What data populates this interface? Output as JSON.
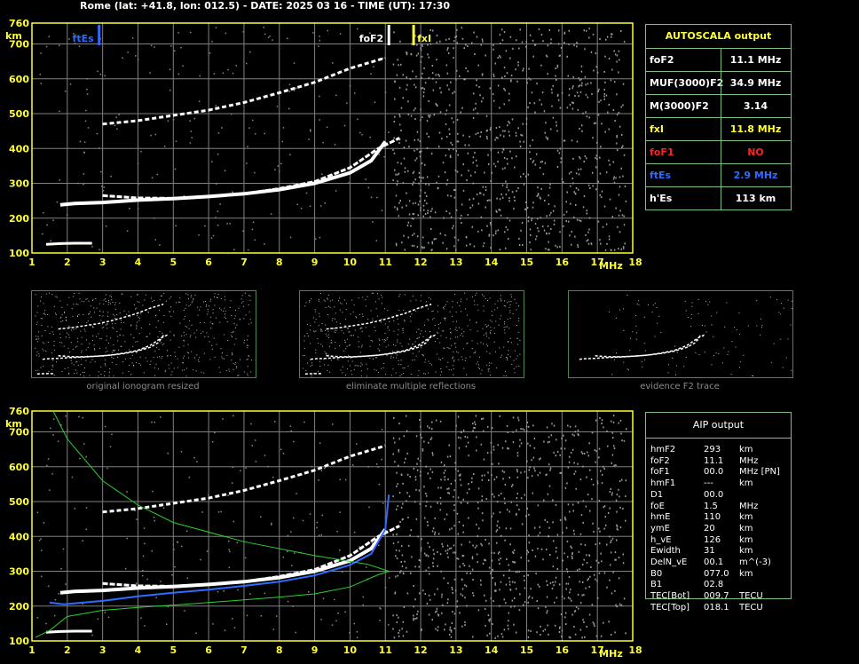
{
  "header": "Rome (lat: +41.8, lon: 012.5) - DATE: 2025 03 16 - TIME (UT): 17:30",
  "colors": {
    "grid": "#808080",
    "axis": "#ffff33",
    "frame": "#ffff33",
    "trace": "#ffffff",
    "blue": "#2f6bff",
    "green": "#2bd12b",
    "red": "#ff2020",
    "panelBorder": "#7fbf7f"
  },
  "chart_data": [
    {
      "type": "scatter",
      "title": "",
      "xlabel": "MHz",
      "ylabel": "km",
      "xlim": [
        1,
        18
      ],
      "ylim": [
        100,
        760
      ],
      "x_ticks": [
        1,
        2,
        3,
        4,
        5,
        6,
        7,
        8,
        9,
        10,
        11,
        12,
        13,
        14,
        15,
        16,
        17,
        18
      ],
      "y_ticks": [
        100,
        200,
        300,
        400,
        500,
        600,
        700,
        760
      ],
      "grid": true,
      "markers": [
        {
          "label": "ftEs",
          "x": 2.9,
          "color": "#2f6bff"
        },
        {
          "label": "foF2",
          "x": 11.1,
          "color": "#ffffff"
        },
        {
          "label": "fxI",
          "x": 11.8,
          "color": "#ffff33"
        }
      ],
      "series": [
        {
          "values": [
            [
              1.4,
              125
            ],
            [
              1.8,
              127
            ],
            [
              2.2,
              128
            ],
            [
              2.7,
              128
            ]
          ]
        },
        {
          "values": [
            [
              1.8,
              238
            ],
            [
              2.2,
              242
            ],
            [
              3,
              245
            ],
            [
              4,
              252
            ],
            [
              5,
              256
            ],
            [
              6,
              262
            ],
            [
              7,
              270
            ],
            [
              8,
              282
            ],
            [
              9,
              300
            ],
            [
              10,
              330
            ],
            [
              10.6,
              365
            ],
            [
              11,
              420
            ]
          ]
        },
        {
          "values": [
            [
              3,
              265
            ],
            [
              4,
              258
            ],
            [
              5,
              257
            ],
            [
              6,
              262
            ],
            [
              7,
              270
            ],
            [
              8,
              285
            ],
            [
              9,
              305
            ],
            [
              10,
              345
            ],
            [
              10.8,
              400
            ],
            [
              11.4,
              430
            ]
          ]
        },
        {
          "values": [
            [
              3,
              470
            ],
            [
              4,
              480
            ],
            [
              5,
              495
            ],
            [
              6,
              510
            ],
            [
              7,
              532
            ],
            [
              8,
              560
            ],
            [
              9,
              590
            ],
            [
              10,
              630
            ],
            [
              11,
              660
            ]
          ]
        }
      ]
    },
    {
      "type": "scatter",
      "title": "",
      "xlabel": "MHz",
      "ylabel": "km",
      "xlim": [
        1,
        18
      ],
      "ylim": [
        100,
        760
      ],
      "x_ticks": [
        1,
        2,
        3,
        4,
        5,
        6,
        7,
        8,
        9,
        10,
        11,
        12,
        13,
        14,
        15,
        16,
        17,
        18
      ],
      "y_ticks": [
        100,
        200,
        300,
        400,
        500,
        600,
        700,
        760
      ],
      "grid": true,
      "series": [
        {
          "values": [
            [
              1.4,
              125
            ],
            [
              1.8,
              127
            ],
            [
              2.2,
              128
            ],
            [
              2.7,
              128
            ]
          ]
        },
        {
          "values": [
            [
              1.8,
              238
            ],
            [
              2.2,
              242
            ],
            [
              3,
              245
            ],
            [
              4,
              252
            ],
            [
              5,
              256
            ],
            [
              6,
              262
            ],
            [
              7,
              270
            ],
            [
              8,
              282
            ],
            [
              9,
              300
            ],
            [
              10,
              330
            ],
            [
              10.6,
              365
            ],
            [
              11,
              420
            ]
          ]
        },
        {
          "values": [
            [
              3,
              265
            ],
            [
              4,
              258
            ],
            [
              5,
              257
            ],
            [
              6,
              262
            ],
            [
              7,
              270
            ],
            [
              8,
              285
            ],
            [
              9,
              305
            ],
            [
              10,
              345
            ],
            [
              10.8,
              400
            ],
            [
              11.4,
              430
            ]
          ]
        },
        {
          "values": [
            [
              3,
              470
            ],
            [
              4,
              480
            ],
            [
              5,
              495
            ],
            [
              6,
              510
            ],
            [
              7,
              532
            ],
            [
              8,
              560
            ],
            [
              9,
              590
            ],
            [
              10,
              630
            ],
            [
              11,
              660
            ]
          ]
        },
        {
          "values": [
            [
              1.5,
              210
            ],
            [
              1.9,
              205
            ],
            [
              3,
              215
            ],
            [
              4,
              228
            ],
            [
              5,
              238
            ],
            [
              6,
              247
            ],
            [
              7,
              258
            ],
            [
              8,
              270
            ],
            [
              9,
              288
            ],
            [
              10,
              318
            ],
            [
              10.6,
              350
            ],
            [
              11,
              420
            ],
            [
              11.1,
              520
            ]
          ]
        },
        {
          "values": [
            [
              1.1,
              110
            ],
            [
              1.5,
              130
            ],
            [
              2,
              170
            ],
            [
              3,
              188
            ],
            [
              4,
              196
            ],
            [
              5,
              203
            ],
            [
              6,
              210
            ],
            [
              7,
              218
            ],
            [
              8,
              226
            ],
            [
              9,
              235
            ],
            [
              10,
              255
            ],
            [
              10.8,
              290
            ],
            [
              11.1,
              300
            ],
            [
              10.5,
              320
            ],
            [
              9,
              345
            ],
            [
              7,
              385
            ],
            [
              5,
              440
            ],
            [
              4,
              490
            ],
            [
              3,
              560
            ],
            [
              2,
              680
            ],
            [
              1.6,
              760
            ]
          ]
        }
      ]
    }
  ],
  "autoscala": {
    "title": "AUTOSCALA output",
    "rows": [
      {
        "key": "foF2",
        "val": "11.1 MHz",
        "color": "#ffffff"
      },
      {
        "key": "MUF(3000)F2",
        "val": "34.9 MHz",
        "color": "#ffffff"
      },
      {
        "key": "M(3000)F2",
        "val": "3.14",
        "color": "#ffffff"
      },
      {
        "key": "fxI",
        "val": "11.8 MHz",
        "color": "#ffff33"
      },
      {
        "key": "foF1",
        "val": "NO",
        "color": "#ff2020"
      },
      {
        "key": "ftEs",
        "val": "2.9 MHz",
        "color": "#2f6bff"
      },
      {
        "key": "h'Es",
        "val": "113    km",
        "color": "#ffffff"
      }
    ]
  },
  "thumbnails": [
    {
      "caption": "original ionogram resized"
    },
    {
      "caption": "eliminate multiple reflections"
    },
    {
      "caption": "evidence F2 trace"
    }
  ],
  "aip": {
    "title": "AIP output",
    "rows": [
      {
        "k": "hmF2",
        "v": "293",
        "u": "km"
      },
      {
        "k": "foF2",
        "v": "11.1",
        "u": "MHz"
      },
      {
        "k": "foF1",
        "v": "00.0",
        "u": "MHz   [PN]"
      },
      {
        "k": "hmF1",
        "v": "---",
        "u": "km"
      },
      {
        "k": "D1",
        "v": "00.0",
        "u": ""
      },
      {
        "k": "foE",
        "v": "1.5",
        "u": "MHz"
      },
      {
        "k": "hmE",
        "v": "110",
        "u": "km"
      },
      {
        "k": "ymE",
        "v": "20",
        "u": "km"
      },
      {
        "k": "h_vE",
        "v": "126",
        "u": "km"
      },
      {
        "k": "Ewidth",
        "v": "31",
        "u": "km"
      },
      {
        "k": "DelN_vE",
        "v": "00.1",
        "u": "m^(-3)"
      },
      {
        "k": "B0",
        "v": "077.0",
        "u": "km"
      },
      {
        "k": "B1",
        "v": "02.8",
        "u": ""
      },
      {
        "k": "TEC[Bot]",
        "v": "009.7",
        "u": "TECU"
      },
      {
        "k": "TEC[Top]",
        "v": "018.1",
        "u": "TECU"
      }
    ]
  }
}
